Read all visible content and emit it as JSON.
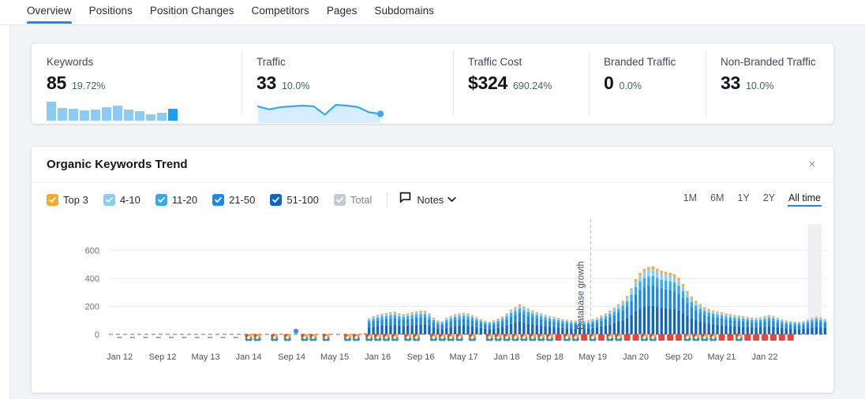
{
  "tabs": [
    {
      "label": "Overview",
      "active": true
    },
    {
      "label": "Positions",
      "active": false
    },
    {
      "label": "Position Changes",
      "active": false
    },
    {
      "label": "Competitors",
      "active": false
    },
    {
      "label": "Pages",
      "active": false
    },
    {
      "label": "Subdomains",
      "active": false
    }
  ],
  "kpis": [
    {
      "label": "Keywords",
      "value": "85",
      "delta": "19.72%",
      "spark": "bars"
    },
    {
      "label": "Traffic",
      "value": "33",
      "delta": "10.0%",
      "spark": "line"
    },
    {
      "label": "Traffic Cost",
      "value": "$324",
      "delta": "690.24%",
      "spark": "none"
    },
    {
      "label": "Branded Traffic",
      "value": "0",
      "delta": "0.0%",
      "spark": "none"
    },
    {
      "label": "Non-Branded Traffic",
      "value": "33",
      "delta": "10.0%",
      "spark": "none"
    }
  ],
  "kpi_spark_bars": [
    22,
    15,
    14,
    12,
    13,
    16,
    17,
    13,
    11,
    7,
    9,
    14
  ],
  "kpi_spark_line": [
    18,
    14,
    17,
    18,
    19,
    18,
    7,
    20,
    19,
    17,
    10,
    8
  ],
  "trend": {
    "title": "Organic Keywords Trend",
    "close_label": "×",
    "legend": [
      {
        "label": "Top 3",
        "color": "#f5ab2e",
        "checked": true,
        "muted": false
      },
      {
        "label": "4-10",
        "color": "#8ccbf6",
        "checked": true,
        "muted": false
      },
      {
        "label": "11-20",
        "color": "#35aaf2",
        "checked": true,
        "muted": false
      },
      {
        "label": "21-50",
        "color": "#1e87e8",
        "checked": true,
        "muted": false
      },
      {
        "label": "51-100",
        "color": "#1164c0",
        "checked": true,
        "muted": false
      },
      {
        "label": "Total",
        "color": "#c5cad0",
        "checked": true,
        "muted": true
      }
    ],
    "notes_label": "Notes",
    "ranges": [
      {
        "label": "1M",
        "active": false
      },
      {
        "label": "6M",
        "active": false
      },
      {
        "label": "1Y",
        "active": false
      },
      {
        "label": "2Y",
        "active": false
      },
      {
        "label": "All time",
        "active": true
      }
    ],
    "annotation": "Database growth"
  },
  "chart_data": {
    "type": "bar",
    "title": "Organic Keywords Trend",
    "stacked": true,
    "xlabel": "",
    "ylabel": "",
    "ylim": [
      0,
      700
    ],
    "yticks": [
      0,
      200,
      400,
      600
    ],
    "grid": true,
    "legend_position": "top-left",
    "xtick_labels": [
      "Jan 12",
      "Sep 12",
      "May 13",
      "Jan 14",
      "Sep 14",
      "May 15",
      "Jan 16",
      "Sep 16",
      "May 17",
      "Jan 18",
      "Sep 18",
      "May 19",
      "Jan 20",
      "Sep 20",
      "May 21",
      "Jan 22"
    ],
    "xtick_indices": [
      2,
      12,
      22,
      32,
      42,
      52,
      62,
      72,
      82,
      92,
      102,
      112,
      122,
      132,
      142,
      152
    ],
    "annotation_line": {
      "label": "Database growth",
      "index": 112
    },
    "series": [
      {
        "name": "Top 3",
        "color": "#f5ab2e"
      },
      {
        "name": "4-10",
        "color": "#8ccbf6"
      },
      {
        "name": "11-20",
        "color": "#35aaf2"
      },
      {
        "name": "21-50",
        "color": "#1e87e8"
      },
      {
        "name": "51-100",
        "color": "#1164c0"
      }
    ],
    "totals": [
      0,
      0,
      0,
      0,
      0,
      0,
      0,
      0,
      0,
      0,
      0,
      0,
      0,
      0,
      0,
      0,
      0,
      0,
      0,
      0,
      0,
      0,
      0,
      0,
      0,
      0,
      0,
      0,
      0,
      0,
      0,
      0,
      0,
      0,
      0,
      0,
      0,
      0,
      0,
      0,
      0,
      0,
      0,
      0,
      0,
      0,
      0,
      0,
      0,
      0,
      0,
      0,
      0,
      0,
      0,
      0,
      0,
      0,
      5,
      8,
      115,
      130,
      140,
      148,
      152,
      158,
      162,
      150,
      145,
      150,
      158,
      165,
      170,
      168,
      150,
      120,
      100,
      95,
      118,
      132,
      145,
      150,
      155,
      150,
      138,
      125,
      110,
      98,
      92,
      100,
      112,
      128,
      150,
      178,
      195,
      215,
      200,
      185,
      172,
      160,
      150,
      140,
      132,
      125,
      118,
      110,
      105,
      100,
      98,
      96,
      95,
      100,
      110,
      120,
      135,
      150,
      170,
      190,
      215,
      240,
      275,
      330,
      395,
      440,
      470,
      482,
      486,
      470,
      455,
      448,
      440,
      430,
      405,
      360,
      310,
      270,
      240,
      215,
      195,
      182,
      172,
      165,
      158,
      150,
      145,
      140,
      135,
      130,
      125,
      120,
      118,
      122,
      130,
      138,
      132,
      120,
      108,
      100,
      95,
      92,
      90,
      95,
      105,
      118,
      128,
      122,
      110
    ]
  }
}
